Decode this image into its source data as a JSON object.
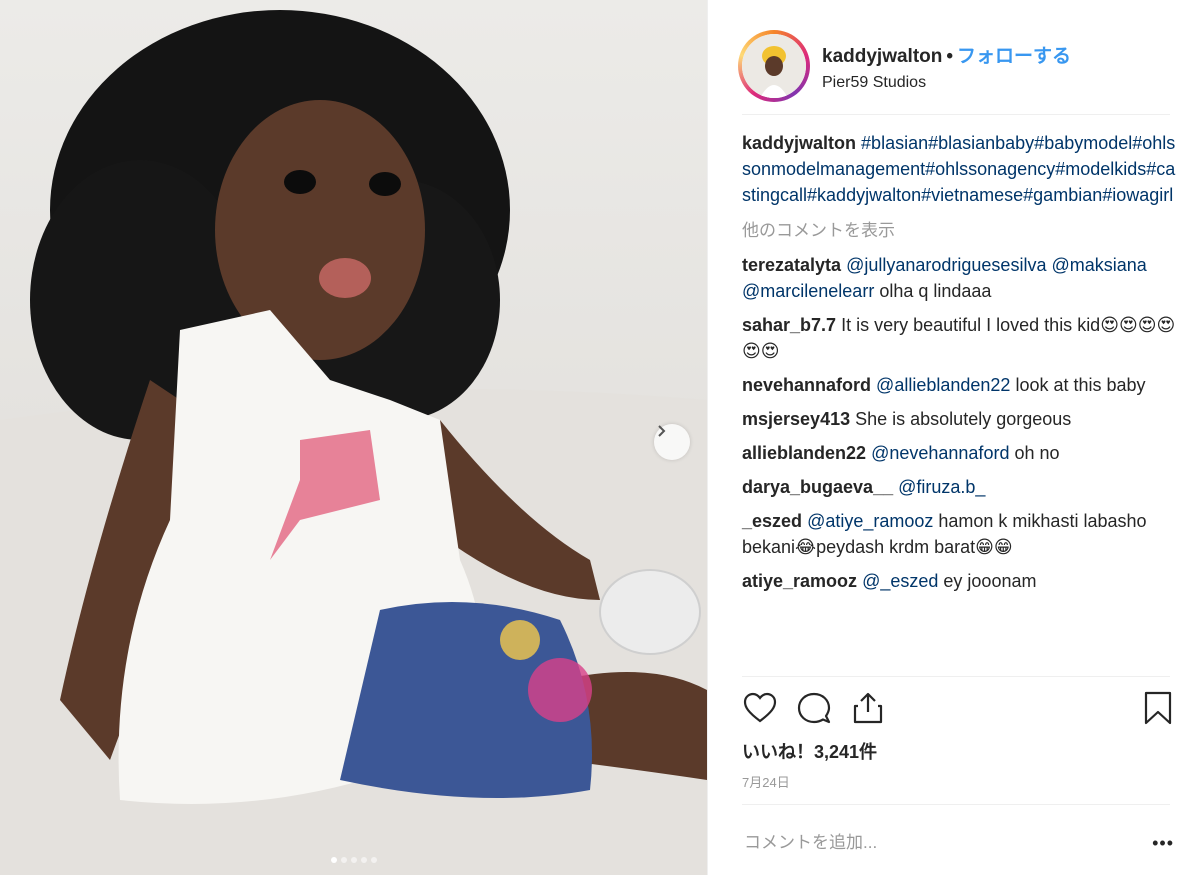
{
  "post": {
    "username": "kaddyjwalton",
    "separator": "•",
    "follow_label": "フォローする",
    "location": "Pier59 Studios",
    "caption_user": "kaddyjwalton",
    "caption_tags": "#blasian#blasianbaby#babymodel#ohlssonmodelmanagement#ohlssonagency#modelkids#castingcall#kaddyjwalton#vietnamese#gambian#iowagirl",
    "more_comments_label": "他のコメントを表示",
    "likes_label": "いいね！3,241件",
    "date_label": "7月24日",
    "add_comment_placeholder": "コメントを追加...",
    "more_options": "•••",
    "carousel": {
      "count": 5,
      "active_index": 0
    }
  },
  "comments": [
    {
      "user": "terezatalyta",
      "mention": "@jullyanarodriguesesilva @maksiana @marcilenelearr",
      "text": " olha q lindaaa"
    },
    {
      "user": "sahar_b7.7",
      "mention": "",
      "text": "It is very beautiful I loved this kid😍😍😍😍😍😍"
    },
    {
      "user": "nevehannaford",
      "mention": "@allieblanden22",
      "text": " look at this baby"
    },
    {
      "user": "msjersey413",
      "mention": "",
      "text": "She is absolutely gorgeous"
    },
    {
      "user": "allieblanden22",
      "mention": "@nevehannaford",
      "text": " oh no"
    },
    {
      "user": "darya_bugaeva__",
      "mention": "@firuza.b_",
      "text": ""
    },
    {
      "user": "_eszed",
      "mention": "@atiye_ramooz",
      "text": " hamon k mikhasti labasho bekani😂peydash krdm barat😁😁"
    },
    {
      "user": "atiye_ramooz",
      "mention": "@_eszed",
      "text": " ey jooonam"
    }
  ],
  "icons": {
    "like": "heart-icon",
    "comment": "comment-icon",
    "share": "share-icon",
    "save": "bookmark-icon",
    "next": "chevron-right-icon"
  },
  "colors": {
    "follow": "#3897f0",
    "hashtag": "#003569",
    "muted": "#999999",
    "text": "#262626"
  }
}
